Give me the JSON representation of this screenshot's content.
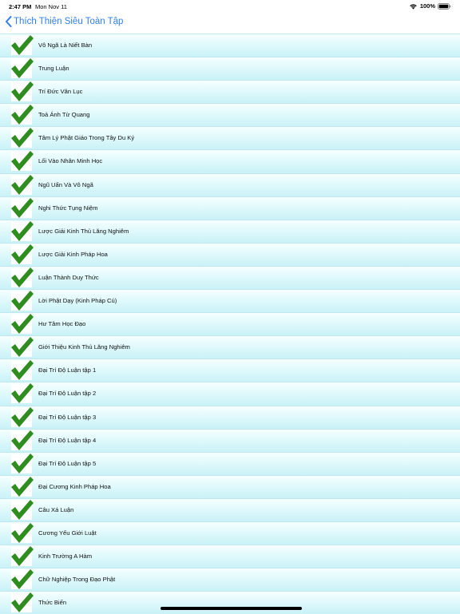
{
  "status_bar": {
    "time": "2:47 PM",
    "date": "Mon Nov 11",
    "battery": "100%"
  },
  "nav": {
    "back_label": "Thích Thiện Siêu Toàn Tập"
  },
  "colors": {
    "accent": "#2f7ff0",
    "check": "#2f8c1e",
    "row_top": "#f6ffff",
    "row_bottom": "#c9f2f7"
  },
  "list": {
    "items": [
      {
        "label": "Vô Ngã Là Niết Bàn"
      },
      {
        "label": "Trung Luận"
      },
      {
        "label": "Trí Đức Văn Lục"
      },
      {
        "label": "Toả Ánh Từ Quang"
      },
      {
        "label": "Tâm Lý Phật Giáo Trong Tây Du Ký"
      },
      {
        "label": "Lối Vào Nhân Minh Học"
      },
      {
        "label": "Ngũ Uẩn Và Vô Ngã"
      },
      {
        "label": "Nghi Thức Tụng Niệm"
      },
      {
        "label": "Lược Giải Kinh Thủ Lăng Nghiêm"
      },
      {
        "label": "Lược Giải Kinh Pháp Hoa"
      },
      {
        "label": "Luận Thành Duy Thức"
      },
      {
        "label": "Lời Phật Dạy (Kinh Pháp Cú)"
      },
      {
        "label": "Hư Tâm Học Đạo"
      },
      {
        "label": "Giới Thiệu Kinh Thủ Lăng Nghiêm"
      },
      {
        "label": "Đại Trí Độ Luận tập 1"
      },
      {
        "label": "Đại Trí Độ Luận tập 2"
      },
      {
        "label": "Đại Trí Độ Luận tập 3"
      },
      {
        "label": "Đại Trí Độ Luận tập 4"
      },
      {
        "label": "Đại Trí Độ Luận tập 5"
      },
      {
        "label": "Đại Cương Kinh Pháp Hoa"
      },
      {
        "label": "Câu Xá Luận"
      },
      {
        "label": "Cương Yếu Giới Luật"
      },
      {
        "label": "Kinh Trường A Hàm"
      },
      {
        "label": "Chữ Nghiệp Trong Đạo Phật"
      },
      {
        "label": "Thức Biến"
      }
    ]
  }
}
